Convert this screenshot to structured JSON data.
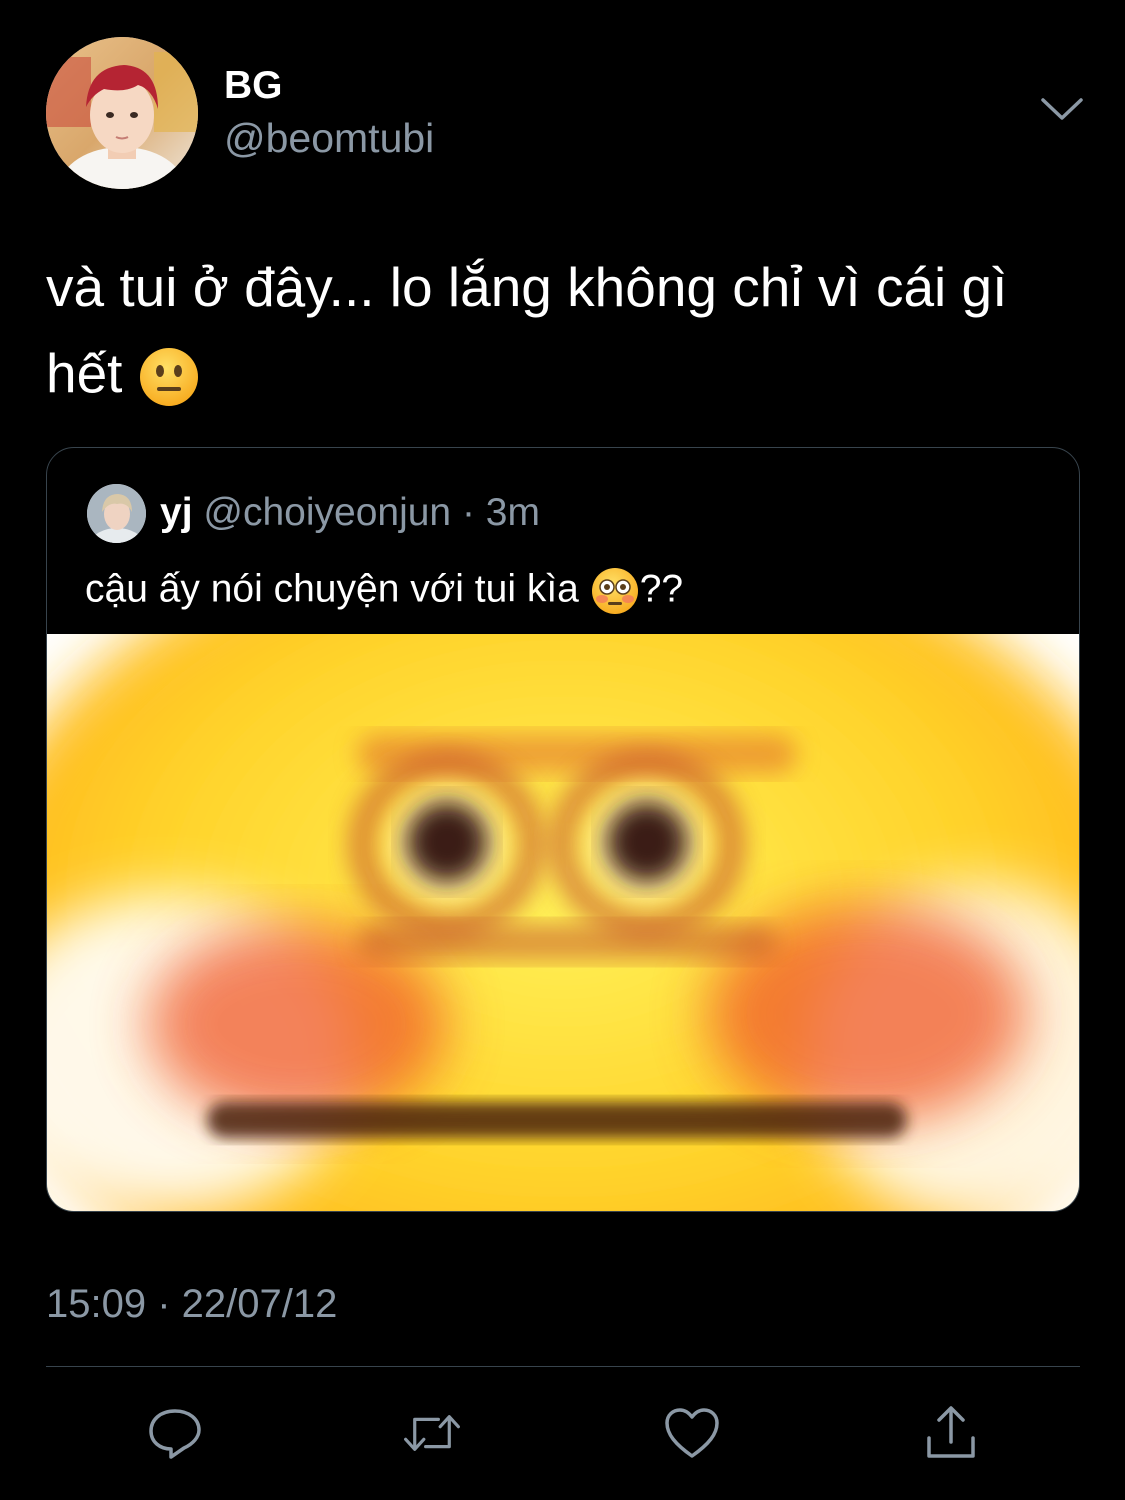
{
  "tweet": {
    "author_name": "BG",
    "author_handle": "@beomtubi",
    "text_main": "và tui ở đây... lo lắng không chỉ vì cái gì hết ",
    "timestamp": "15:09 · 22/07/12"
  },
  "quote": {
    "author_name": "yj",
    "author_handle": "@choiyeonjun",
    "separator": " · ",
    "age": "3m",
    "text_main": "cậu ấy nói chuyện với tui kìa ",
    "text_suffix": "??"
  },
  "icons": {
    "caret": "chevron-down-icon",
    "reply": "reply-icon",
    "retweet": "retweet-icon",
    "like": "heart-icon",
    "share": "share-icon",
    "emoji_tweet": "neutral-face-emoji",
    "emoji_quote": "flushed-face-emoji"
  },
  "colors": {
    "background": "#000000",
    "text": "#ffffff",
    "muted": "#8b98a5",
    "border": "#38444d"
  }
}
